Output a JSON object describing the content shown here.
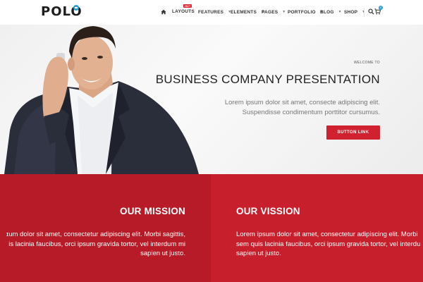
{
  "header": {
    "logo": "POLO",
    "nav": [
      {
        "label": "LAYOUTS",
        "dropdown": false
      },
      {
        "label": "FEATURES",
        "dropdown": true
      },
      {
        "label": "ELEMENTS",
        "dropdown": true
      },
      {
        "label": "PAGES",
        "dropdown": true
      },
      {
        "label": "PORTFOLIO",
        "dropdown": true
      },
      {
        "label": "BLOG",
        "dropdown": true
      },
      {
        "label": "SHOP",
        "dropdown": true
      }
    ],
    "hot_badge": "HOT",
    "cart_count": "0",
    "icons": {
      "home": "home-icon",
      "search": "search-icon",
      "cart": "cart-icon"
    },
    "logo_accent_color": "#2a9fd6"
  },
  "hero": {
    "welcome": "WELCOME TO",
    "title": "BUSINESS COMPANY PRESENTATION",
    "text_line1": "Lorem ipsum dolor sit amet, consecte adipiscing elit.",
    "text_line2": "Suspendisse condimentum porttitor cursumus.",
    "button": "BUTTON LINK",
    "button_color": "#d0212f"
  },
  "mission": {
    "title": "OUR MISSION",
    "line1": "ɪum dolor sit amet, consectetur adipiscing elit. Morbi sagittis,",
    "line2": "is lacinia faucibus, orci ipsum gravida tortor, vel interdum mi",
    "line3": "sapien ut justo.",
    "color": "#b71b27"
  },
  "vision": {
    "title": "OUR VISSION",
    "line1": "Lorem ipsum dolor sit amet, consectetur adipiscing elit. Morbi",
    "line2": "sem quis lacinia faucibus, orci ipsum gravida tortor, vel interdu",
    "line3": "sapien ut justo.",
    "color": "#c81f2d"
  }
}
